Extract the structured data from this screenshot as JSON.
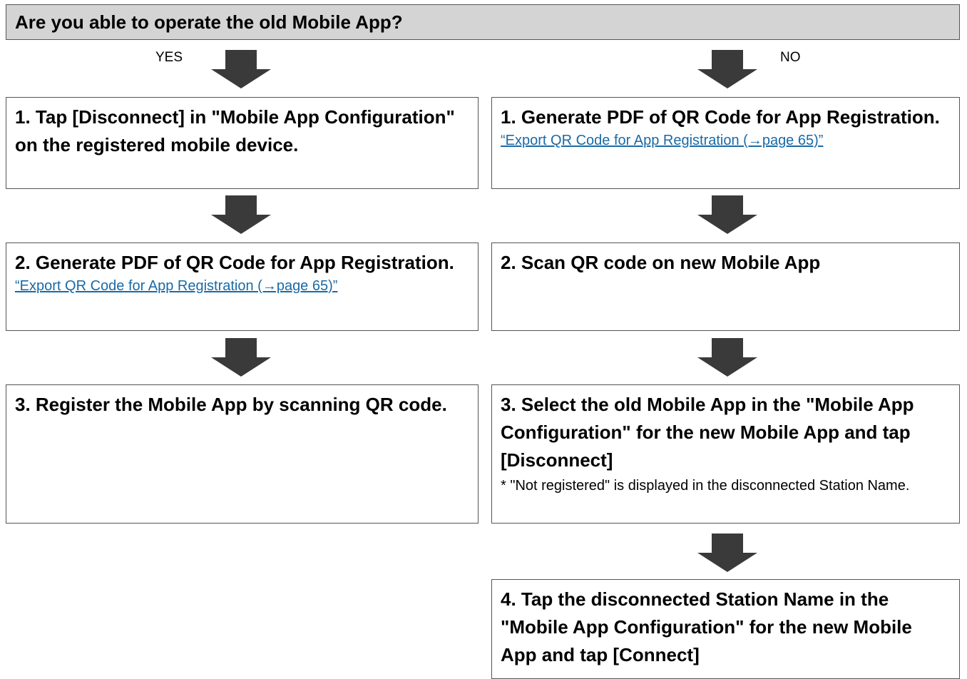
{
  "header": {
    "question": "Are you able to operate the old Mobile App?"
  },
  "branches": {
    "yes": {
      "label": "YES",
      "steps": [
        {
          "title": "1. Tap [Disconnect] in \"Mobile App Configuration\" on the registered mobile device."
        },
        {
          "title": "2. Generate PDF of QR Code for App Registration.",
          "link": "“Export QR Code for App Registration (→page 65)”"
        },
        {
          "title": "3. Register the Mobile App by scanning QR code."
        }
      ]
    },
    "no": {
      "label": "NO",
      "steps": [
        {
          "title": "1. Generate PDF of QR Code for App Registration.",
          "link": "“Export QR Code for App Registration (→page 65)”"
        },
        {
          "title": "2. Scan QR code on new Mobile App"
        },
        {
          "title": "3. Select the old Mobile App in the \"Mobile App Configuration\" for the new Mobile App and tap [Disconnect]",
          "note": "* \"Not registered\" is displayed in the disconnected Station Name."
        },
        {
          "title": "4. Tap the disconnected Station Name in the \"Mobile App Configuration\" for the new Mobile App and tap [Connect]"
        }
      ]
    }
  },
  "colors": {
    "header_bg": "#d4d4d4",
    "arrow": "#3a3a3a",
    "link": "#1a6aa6",
    "border": "#555555"
  }
}
